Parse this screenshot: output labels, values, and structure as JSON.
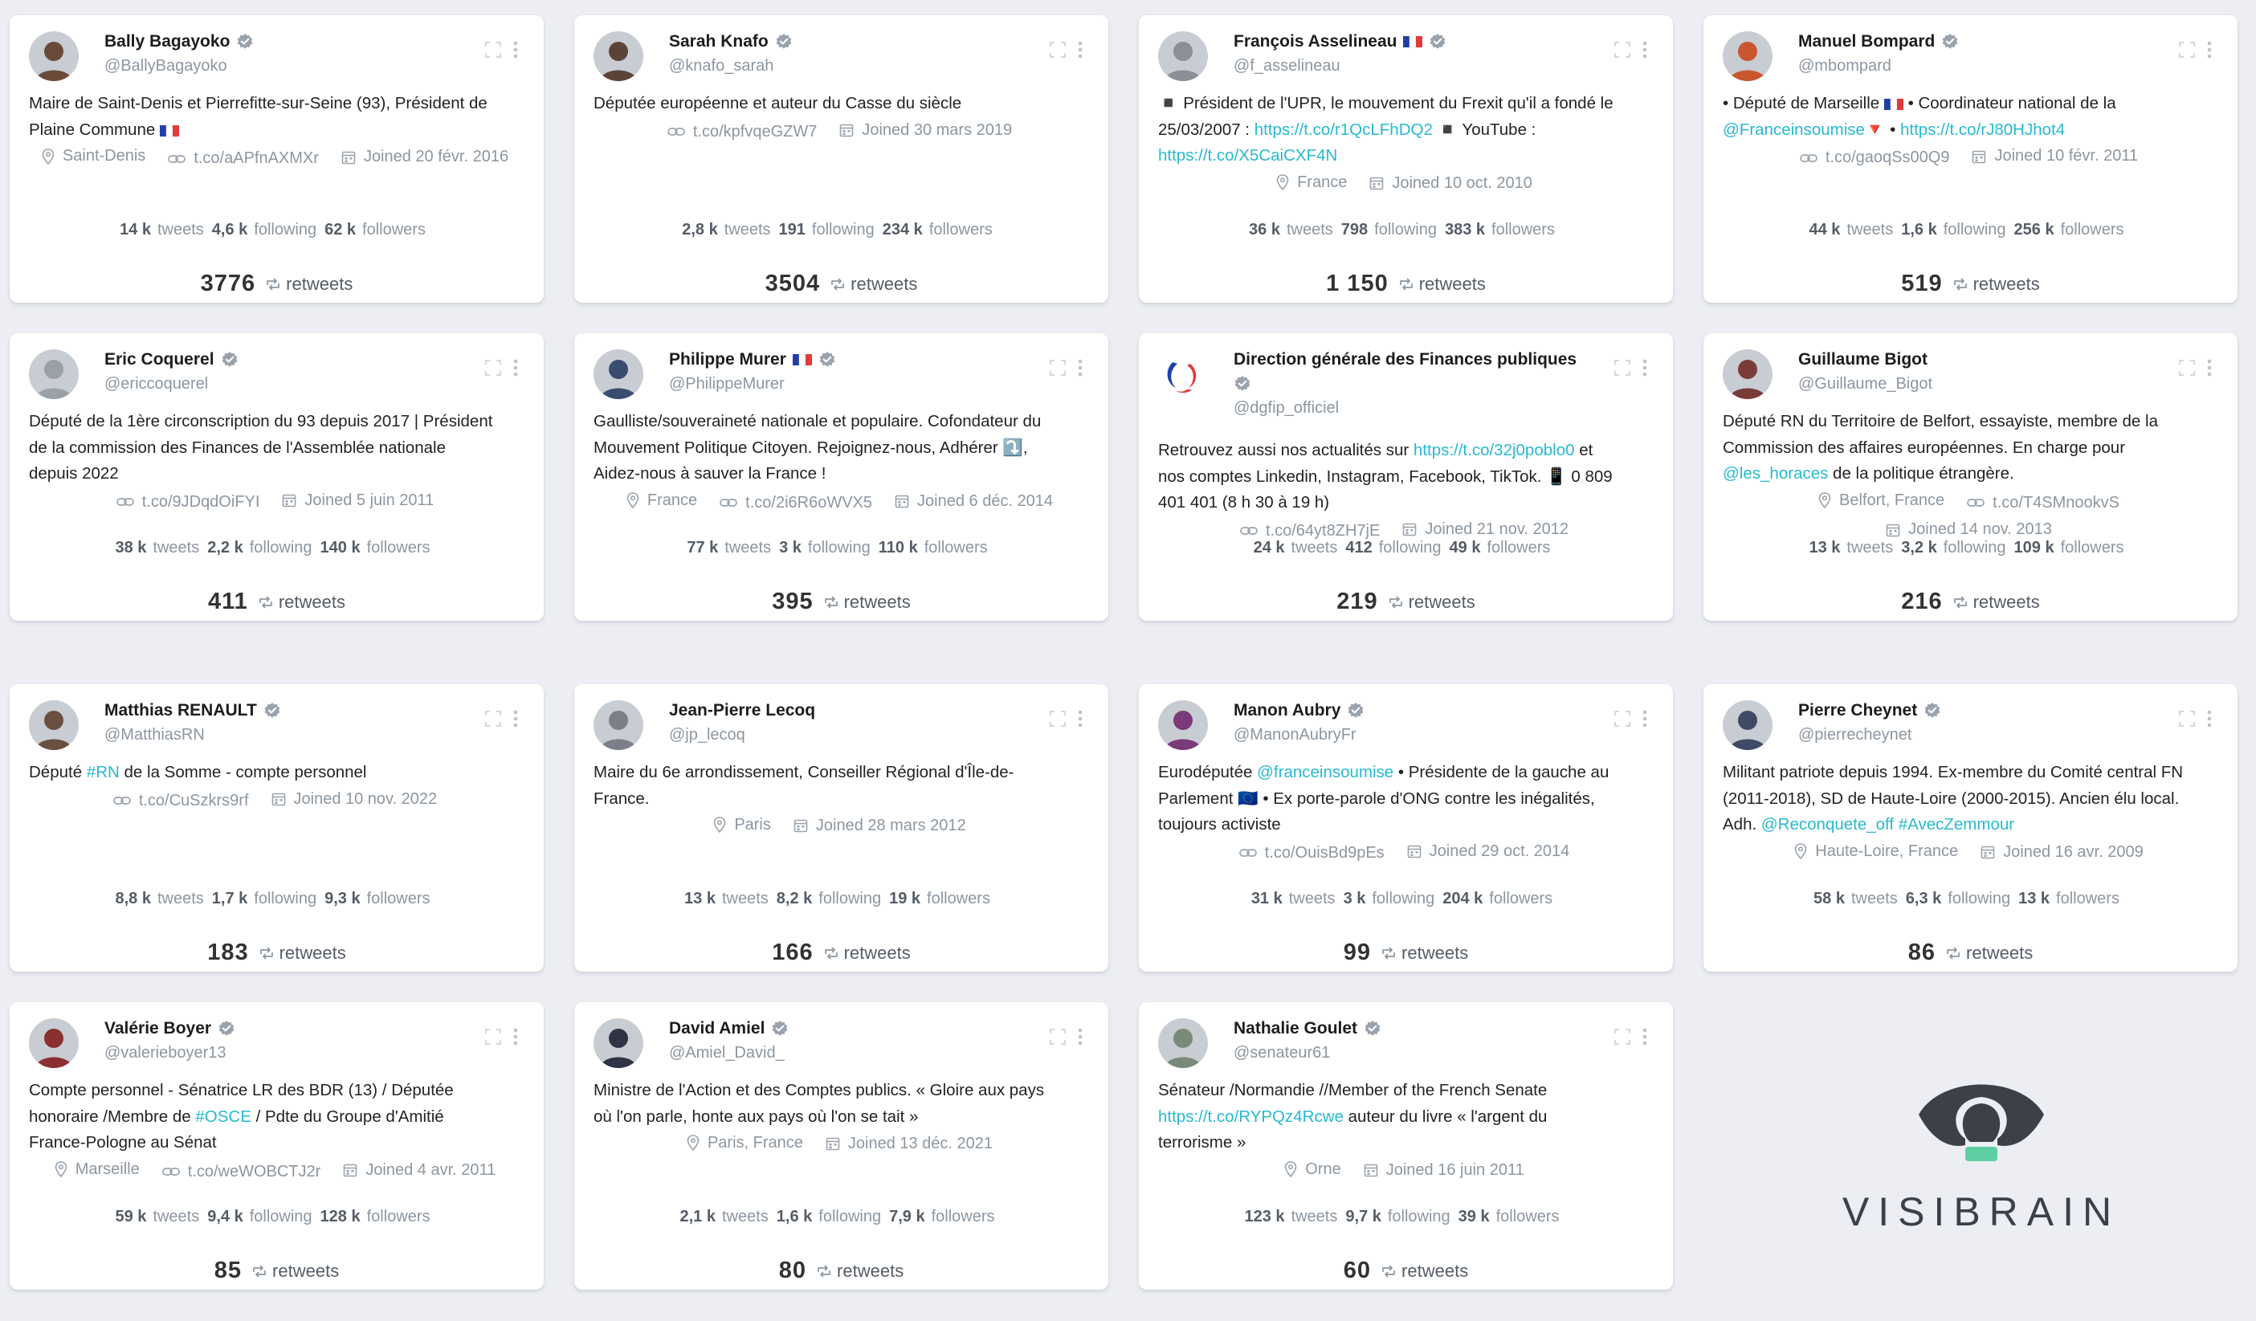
{
  "labels": {
    "tweets": "tweets",
    "following": "following",
    "followers": "followers",
    "retweets": "retweets"
  },
  "cards": [
    {
      "name": "Bally Bagayoko",
      "verified": true,
      "flag": false,
      "handle": "@BallyBagayoko",
      "bio_lines": [
        [
          {
            "t": "Maire de Saint-Denis et Pierrefitte-sur-Seine (93), Président de"
          }
        ],
        [
          {
            "t": "Plaine Commune "
          },
          {
            "t": "🇫🇷",
            "k": "flag"
          }
        ]
      ],
      "meta_lines": [
        [
          {
            "i": "pin",
            "t": "Saint-Denis"
          },
          {
            "i": "link",
            "t": "t.co/aAPfnAXMXr"
          },
          {
            "i": "cal",
            "t": "Joined 20 févr. 2016"
          }
        ]
      ],
      "tweets": "14 k",
      "following": "4,6 k",
      "followers": "62 k",
      "retweets": "3776",
      "avatar_color": "#6b4a3a"
    },
    {
      "name": "Sarah Knafo",
      "verified": true,
      "flag": false,
      "handle": "@knafo_sarah",
      "bio_lines": [
        [
          {
            "t": "Députée européenne et auteur du Casse du siècle"
          }
        ]
      ],
      "meta_lines": [
        [
          {
            "i": "link",
            "t": "t.co/kpfvqeGZW7"
          },
          {
            "i": "cal",
            "t": "Joined 30 mars 2019"
          }
        ]
      ],
      "tweets": "2,8 k",
      "following": "191",
      "followers": "234 k",
      "retweets": "3504",
      "avatar_color": "#5a4438"
    },
    {
      "name": "François Asselineau",
      "verified": true,
      "flag": true,
      "handle": "@f_asselineau",
      "bio_lines": [
        [
          {
            "t": "◾ Président de l'UPR, le mouvement du Frexit qu'il a fondé le"
          }
        ],
        [
          {
            "t": "25/03/2007 : "
          },
          {
            "t": "https://t.co/r1QcLFhDQ2",
            "k": "link"
          },
          {
            "t": " ◾ YouTube :"
          }
        ],
        [
          {
            "t": "https://t.co/X5CaiCXF4N",
            "k": "link"
          }
        ]
      ],
      "meta_lines": [
        [
          {
            "i": "pin",
            "t": "France"
          },
          {
            "i": "cal",
            "t": "Joined 10 oct. 2010"
          }
        ]
      ],
      "tweets": "36 k",
      "following": "798",
      "followers": "383 k",
      "retweets": "1 150",
      "avatar_color": "#8a8f98"
    },
    {
      "name": "Manuel Bompard",
      "verified": true,
      "flag": false,
      "handle": "@mbompard",
      "bio_lines": [
        [
          {
            "t": "• Député de Marseille "
          },
          {
            "t": "🇫🇷",
            "k": "flag"
          },
          {
            "t": " • Coordinateur national de la"
          }
        ],
        [
          {
            "t": "@Franceinsoumise",
            "k": "link"
          },
          {
            "t": "🔻 • "
          },
          {
            "t": "https://t.co/rJ80HJhot4",
            "k": "link"
          }
        ]
      ],
      "meta_lines": [
        [
          {
            "i": "link",
            "t": "t.co/gaoqSs00Q9"
          },
          {
            "i": "cal",
            "t": "Joined 10 févr. 2011"
          }
        ]
      ],
      "tweets": "44 k",
      "following": "1,6 k",
      "followers": "256 k",
      "retweets": "519",
      "avatar_color": "#c9562e"
    },
    {
      "name": "Eric Coquerel",
      "verified": true,
      "flag": false,
      "handle": "@ericcoquerel",
      "bio_lines": [
        [
          {
            "t": "Député de la 1ère circonscription du 93 depuis 2017 | Président"
          }
        ],
        [
          {
            "t": "de la commission des Finances de l'Assemblée nationale"
          }
        ],
        [
          {
            "t": "depuis 2022"
          }
        ]
      ],
      "meta_lines": [
        [
          {
            "i": "link",
            "t": "t.co/9JDqdOiFYI"
          },
          {
            "i": "cal",
            "t": "Joined 5 juin 2011"
          }
        ]
      ],
      "tweets": "38 k",
      "following": "2,2 k",
      "followers": "140 k",
      "retweets": "411",
      "avatar_color": "#9aa0a8"
    },
    {
      "name": "Philippe Murer",
      "verified": true,
      "flag": true,
      "handle": "@PhilippeMurer",
      "bio_lines": [
        [
          {
            "t": "Gaulliste/souveraineté nationale et populaire. Cofondateur du"
          }
        ],
        [
          {
            "t": "Mouvement Politique Citoyen. Rejoignez-nous, Adhérer ⤵️,"
          }
        ],
        [
          {
            "t": "Aidez-nous à sauver la France !"
          }
        ]
      ],
      "meta_lines": [
        [
          {
            "i": "pin",
            "t": "France"
          },
          {
            "i": "link",
            "t": "t.co/2i6R6oWVX5"
          },
          {
            "i": "cal",
            "t": "Joined 6 déc. 2014"
          }
        ]
      ],
      "tweets": "77 k",
      "following": "3 k",
      "followers": "110 k",
      "retweets": "395",
      "avatar_color": "#3a4c72"
    },
    {
      "name": "Direction générale des Finances publiques",
      "verified": true,
      "flag": false,
      "handle": "@dgfip_officiel",
      "bio_lines": [
        [
          {
            "t": "Retrouvez aussi nos actualités sur "
          },
          {
            "t": "https://t.co/32j0poblo0",
            "k": "link"
          },
          {
            "t": " et"
          }
        ],
        [
          {
            "t": "nos comptes Linkedin, Instagram, Facebook, TikTok. 📱 0 809"
          }
        ],
        [
          {
            "t": "401 401 (8 h 30 à 19 h)"
          }
        ]
      ],
      "meta_lines": [
        [
          {
            "i": "link",
            "t": "t.co/64yt8ZH7jE"
          },
          {
            "i": "cal",
            "t": "Joined 21 nov. 2012"
          }
        ]
      ],
      "tweets": "24 k",
      "following": "412",
      "followers": "49 k",
      "retweets": "219",
      "avatar_color": "#ffffff"
    },
    {
      "name": "Guillaume Bigot",
      "verified": false,
      "flag": false,
      "handle": "@Guillaume_Bigot",
      "bio_lines": [
        [
          {
            "t": "Député RN du Territoire de Belfort, essayiste, membre de la"
          }
        ],
        [
          {
            "t": "Commission des affaires européennes. En charge pour"
          }
        ],
        [
          {
            "t": "@les_horaces",
            "k": "link"
          },
          {
            "t": " de la politique étrangère."
          }
        ]
      ],
      "meta_lines": [
        [
          {
            "i": "pin",
            "t": "Belfort, France"
          },
          {
            "i": "link",
            "t": "t.co/T4SMnookvS"
          }
        ],
        [
          {
            "i": "cal",
            "t": "Joined 14 nov. 2013"
          }
        ]
      ],
      "tweets": "13 k",
      "following": "3,2 k",
      "followers": "109 k",
      "retweets": "216",
      "avatar_color": "#7a3c38"
    },
    {
      "name": "Matthias RENAULT",
      "verified": true,
      "flag": false,
      "handle": "@MatthiasRN",
      "bio_lines": [
        [
          {
            "t": "Député "
          },
          {
            "t": "#RN",
            "k": "link"
          },
          {
            "t": " de la Somme - compte personnel"
          }
        ]
      ],
      "meta_lines": [
        [
          {
            "i": "link",
            "t": "t.co/CuSzkrs9rf"
          },
          {
            "i": "cal",
            "t": "Joined 10 nov. 2022"
          }
        ]
      ],
      "tweets": "8,8 k",
      "following": "1,7 k",
      "followers": "9,3 k",
      "retweets": "183",
      "avatar_color": "#6a5040"
    },
    {
      "name": "Jean-Pierre Lecoq",
      "verified": false,
      "flag": false,
      "handle": "@jp_lecoq",
      "bio_lines": [
        [
          {
            "t": "Maire du 6e arrondissement, Conseiller Régional d'Île-de-"
          }
        ],
        [
          {
            "t": "France."
          }
        ]
      ],
      "meta_lines": [
        [
          {
            "i": "pin",
            "t": "Paris"
          },
          {
            "i": "cal",
            "t": "Joined 28 mars 2012"
          }
        ]
      ],
      "tweets": "13 k",
      "following": "8,2 k",
      "followers": "19 k",
      "retweets": "166",
      "avatar_color": "#7a7f88"
    },
    {
      "name": "Manon Aubry",
      "verified": true,
      "flag": false,
      "handle": "@ManonAubryFr",
      "bio_lines": [
        [
          {
            "t": "Eurodéputée "
          },
          {
            "t": "@franceinsoumise",
            "k": "link"
          },
          {
            "t": " • Présidente de la gauche au"
          }
        ],
        [
          {
            "t": "Parlement 🇪🇺 • Ex porte-parole d'ONG contre les inégalités,"
          }
        ],
        [
          {
            "t": "toujours activiste"
          }
        ]
      ],
      "meta_lines": [
        [
          {
            "i": "link",
            "t": "t.co/OuisBd9pEs"
          },
          {
            "i": "cal",
            "t": "Joined 29 oct. 2014"
          }
        ]
      ],
      "tweets": "31 k",
      "following": "3 k",
      "followers": "204 k",
      "retweets": "99",
      "avatar_color": "#7a3a78"
    },
    {
      "name": "Pierre Cheynet",
      "verified": true,
      "flag": false,
      "handle": "@pierrecheynet",
      "bio_lines": [
        [
          {
            "t": "Militant patriote depuis 1994. Ex-membre du Comité central FN"
          }
        ],
        [
          {
            "t": "(2011-2018), SD de Haute-Loire (2000-2015). Ancien élu local."
          }
        ],
        [
          {
            "t": "Adh. "
          },
          {
            "t": "@Reconquete_off",
            "k": "link"
          },
          {
            "t": " "
          },
          {
            "t": "#AvecZemmour",
            "k": "link"
          }
        ]
      ],
      "meta_lines": [
        [
          {
            "i": "pin",
            "t": "Haute-Loire, France"
          },
          {
            "i": "cal",
            "t": "Joined 16 avr. 2009"
          }
        ]
      ],
      "tweets": "58 k",
      "following": "6,3 k",
      "followers": "13 k",
      "retweets": "86",
      "avatar_color": "#3e4a66"
    },
    {
      "name": "Valérie Boyer",
      "verified": true,
      "flag": false,
      "handle": "@valerieboyer13",
      "bio_lines": [
        [
          {
            "t": "Compte personnel - Sénatrice LR des BDR (13) / Députée"
          }
        ],
        [
          {
            "t": "honoraire /Membre de "
          },
          {
            "t": "#OSCE",
            "k": "link"
          },
          {
            "t": " / Pdte du Groupe d'Amitié"
          }
        ],
        [
          {
            "t": "France-Pologne au Sénat"
          }
        ]
      ],
      "meta_lines": [
        [
          {
            "i": "pin",
            "t": "Marseille"
          },
          {
            "i": "link",
            "t": "t.co/weWOBCTJ2r"
          },
          {
            "i": "cal",
            "t": "Joined 4 avr. 2011"
          }
        ]
      ],
      "tweets": "59 k",
      "following": "9,4 k",
      "followers": "128 k",
      "retweets": "85",
      "avatar_color": "#8a3030"
    },
    {
      "name": "David Amiel",
      "verified": true,
      "flag": false,
      "handle": "@Amiel_David_",
      "bio_lines": [
        [
          {
            "t": "Ministre de l'Action et des Comptes publics. « Gloire aux pays"
          }
        ],
        [
          {
            "t": "où l'on parle, honte aux pays où l'on se tait »"
          }
        ]
      ],
      "meta_lines": [
        [
          {
            "i": "pin",
            "t": "Paris, France"
          },
          {
            "i": "cal",
            "t": "Joined 13 déc. 2021"
          }
        ]
      ],
      "tweets": "2,1 k",
      "following": "1,6 k",
      "followers": "7,9 k",
      "retweets": "80",
      "avatar_color": "#2e3444"
    },
    {
      "name": "Nathalie Goulet",
      "verified": true,
      "flag": false,
      "handle": "@senateur61",
      "bio_lines": [
        [
          {
            "t": "Sénateur /Normandie //Member of the French Senate"
          }
        ],
        [
          {
            "t": "https://t.co/RYPQz4Rcwe",
            "k": "link"
          },
          {
            "t": " auteur du livre « l'argent du"
          }
        ],
        [
          {
            "t": "terrorisme »"
          }
        ]
      ],
      "meta_lines": [
        [
          {
            "i": "pin",
            "t": "Orne"
          },
          {
            "i": "cal",
            "t": "Joined 16 juin 2011"
          }
        ]
      ],
      "tweets": "123 k",
      "following": "9,7 k",
      "followers": "39 k",
      "retweets": "60",
      "avatar_color": "#7a8a78"
    }
  ],
  "logo": {
    "text": "VISIBRAIN",
    "colors": {
      "eye": "#3c4049",
      "bulb": "#5ecfa3"
    }
  },
  "theme": {
    "link_color": "#27b9d1",
    "verified_color": "#1da1f2",
    "verified_gray_color": "#9aa3ad",
    "background": "#eceef3"
  }
}
